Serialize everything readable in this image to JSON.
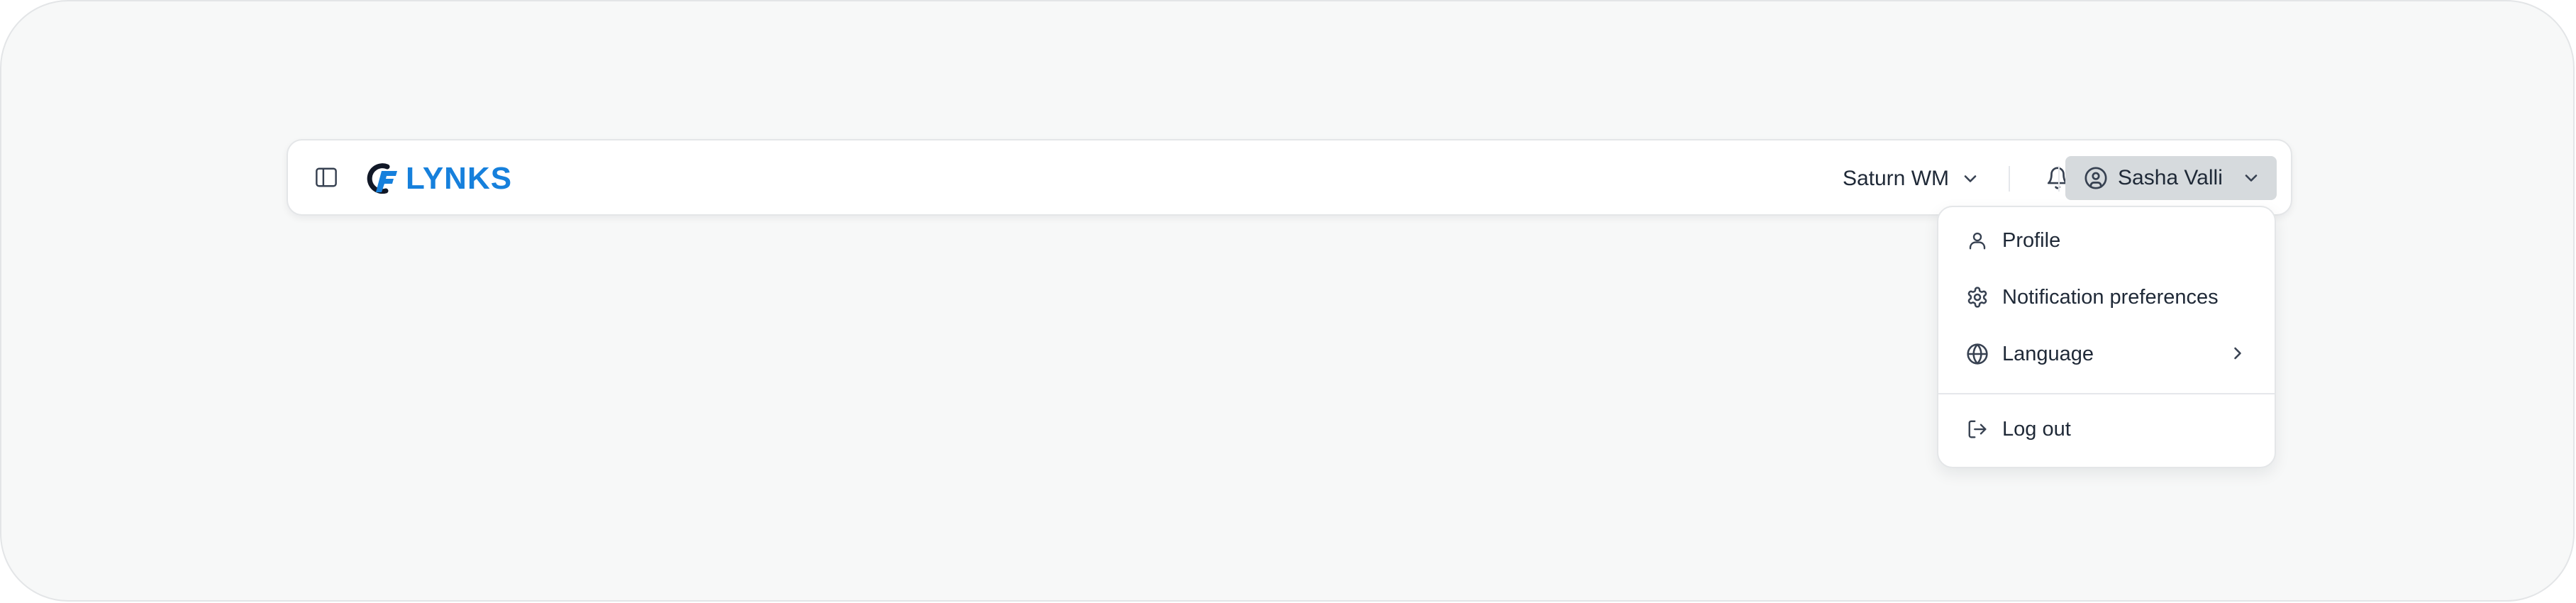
{
  "header": {
    "logo_text": "LYNKS",
    "org_name": "Saturn WM",
    "user_name": "Sasha Valli"
  },
  "user_menu": {
    "items": [
      {
        "label": "Profile",
        "icon": "user-icon"
      },
      {
        "label": "Notification preferences",
        "icon": "gear-icon"
      },
      {
        "label": "Language",
        "icon": "globe-icon",
        "has_submenu": true
      },
      {
        "label": "Log out",
        "icon": "logout-icon"
      }
    ]
  },
  "colors": {
    "brand": "#1680dc",
    "page_bg": "#f7f8f8",
    "user_button_bg": "#d6dadd",
    "text": "#1f2937"
  }
}
